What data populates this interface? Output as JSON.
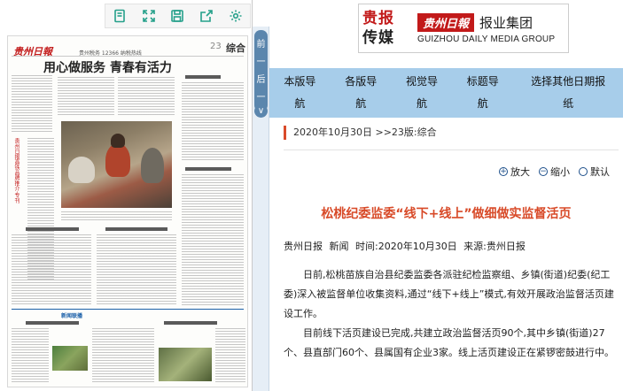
{
  "toolbar": {
    "icons": [
      "copy-icon",
      "fullscreen-icon",
      "save-icon",
      "share-icon",
      "settings-icon"
    ]
  },
  "newspaper": {
    "masthead": "贵州日報",
    "page_no": "23",
    "section": "综合",
    "kicker": "贵州税务 12366 纳税热线",
    "headline": "用心做服务  青春有活力",
    "sidebar_text": "贵州日报高铁品牌推介·专刊",
    "section_band": "新闻联播"
  },
  "strip": {
    "tab_chars": [
      "前",
      "一",
      "后",
      "一"
    ],
    "scroll_btn": "∨"
  },
  "logo": {
    "line1": "贵报",
    "line2": "传媒",
    "paper_name": "贵州日報",
    "group": "报业集团",
    "english": "GUIZHOU DAILY MEDIA GROUP"
  },
  "nav": {
    "items": [
      {
        "line1": "本版导",
        "line2": "航"
      },
      {
        "line1": "各版导",
        "line2": "航"
      },
      {
        "line1": "视觉导",
        "line2": "航"
      },
      {
        "line1": "标题导",
        "line2": "航"
      },
      {
        "line1": "选择其他日期报",
        "line2": "纸"
      }
    ]
  },
  "breadcrumb": "2020年10月30日 >>23版:综合",
  "zoom": {
    "enlarge": "放大",
    "shrink": "缩小",
    "default": "默认"
  },
  "article": {
    "title": "松桃纪委监委“线下+线上”做细做实监督活页",
    "meta": "贵州日报 新闻  时间:2020年10月30日  来源:贵州日报",
    "paragraphs": [
      "日前,松桃苗族自治县纪委监委各派驻纪检监察组、乡镇(街道)纪委(纪工委)深入被监督单位收集资料,通过“线下+线上”模式,有效开展政治监督活页建设工作。",
      "目前线下活页建设已完成,共建立政治监督活页90个,其中乡镇(街道)27个、县直部门60个、县属国有企业3家。线上活页建设正在紧锣密鼓进行中。"
    ]
  },
  "colors": {
    "accent_red": "#d84a28",
    "nav_bg": "#a7cdea",
    "toolbar_icon": "#25a08a"
  }
}
